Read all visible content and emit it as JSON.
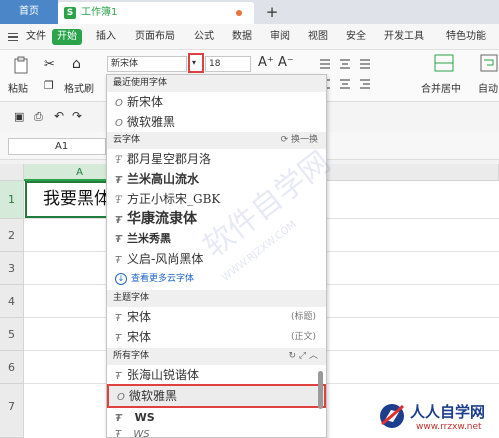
{
  "tabs": {
    "home": "首页",
    "document": "工作簿1",
    "new_tab": "+"
  },
  "menu": {
    "file": "文件",
    "start": "开始",
    "items": [
      "插入",
      "页面布局",
      "公式",
      "数据",
      "审阅",
      "视图",
      "安全",
      "开发工具",
      "特色功能"
    ]
  },
  "ribbon": {
    "paste": "粘贴",
    "format_painter": "格式刷",
    "font_name": "新宋体",
    "font_size": "18",
    "merge": "合并居中",
    "autowrap": "自动"
  },
  "formula_bar": {
    "cell_ref": "A1"
  },
  "sheet": {
    "columns": [
      "A"
    ],
    "rows": [
      "1",
      "2",
      "3",
      "4",
      "5",
      "6",
      "7"
    ],
    "a1_text": "我要黑体"
  },
  "dropdown": {
    "recent_header": "最近使用字体",
    "recent_fonts": [
      "新宋体",
      "微软雅黑"
    ],
    "cloud_header": "云字体",
    "cloud_action": "换一换",
    "cloud_fonts": [
      "郡月星空郡月洛",
      "兰米高山流水",
      "方正小标宋_GBK",
      "华康流隶体",
      "兰米秀黑",
      "义启-风尚黑体"
    ],
    "more_cloud": "查看更多云字体",
    "theme_header": "主题字体",
    "theme_fonts": [
      {
        "name": "宋体",
        "tag": "(标题)"
      },
      {
        "name": "宋体",
        "tag": "(正文)"
      }
    ],
    "all_header": "所有字体",
    "all_fonts": [
      "张海山锐谐体",
      "微软雅黑",
      "WS",
      "WS"
    ]
  },
  "watermark": {
    "text": "软件自学网",
    "url": "WWW.RJZXW.COM"
  },
  "logo": {
    "name": "人人自学网",
    "url": "www.rrzxw.net"
  },
  "colors": {
    "accent_green": "#2aa34a",
    "highlight_red": "#e04040",
    "home_tab_blue": "#4a86c8"
  }
}
